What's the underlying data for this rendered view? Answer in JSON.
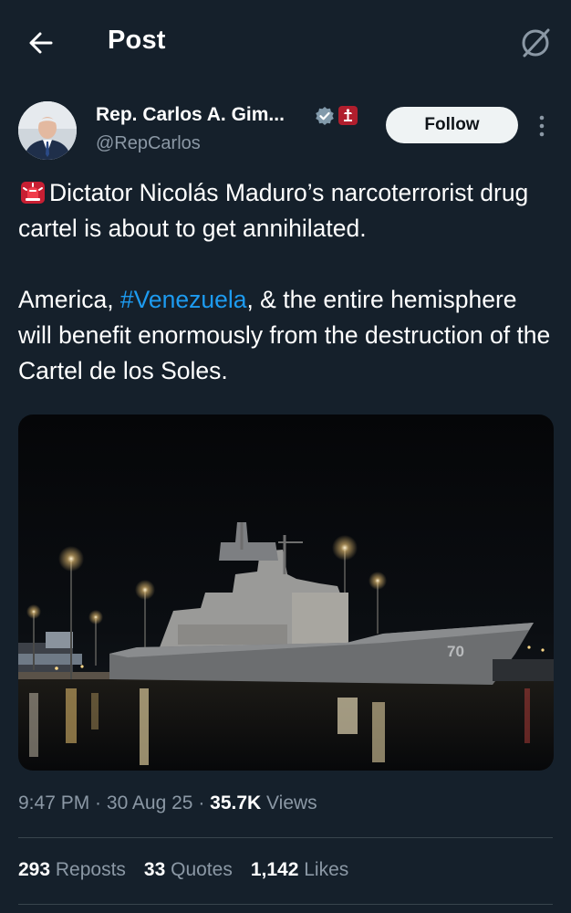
{
  "header": {
    "title": "Post",
    "back_icon": "arrow-left-icon",
    "grok_icon": "grok-icon"
  },
  "author": {
    "name": "Rep. Carlos A. Gim...",
    "handle": "@RepCarlos",
    "verified_icon": "verified-badge-icon",
    "affiliation_icon": "affiliation-badge-icon",
    "follow_label": "Follow",
    "more_icon": "more-vertical-icon"
  },
  "tweet": {
    "line1_icon": "police-light-icon",
    "line1": "Dictator Nicolás Maduro’s narcoterrorist drug cartel is about to get annihilated.",
    "line2_before": "America, ",
    "hashtag": "#Venezuela",
    "line2_after": ", & the entire hemisphere will benefit enormously from the destruction of the Cartel de los Soles."
  },
  "media": {
    "hull_number": "70"
  },
  "meta": {
    "time": "9:47 PM",
    "sep1": " · ",
    "date": "30 Aug 25",
    "sep2": " · ",
    "views_count": "35.7K",
    "views_label": " Views"
  },
  "stats": {
    "reposts_count": "293",
    "reposts_label": " Reposts",
    "quotes_count": "33",
    "quotes_label": " Quotes",
    "likes_count": "1,142",
    "likes_label": " Likes"
  },
  "colors": {
    "background": "#15202b",
    "secondary_text": "#8b98a5",
    "link": "#1d9bf0",
    "divider": "#38444d"
  }
}
